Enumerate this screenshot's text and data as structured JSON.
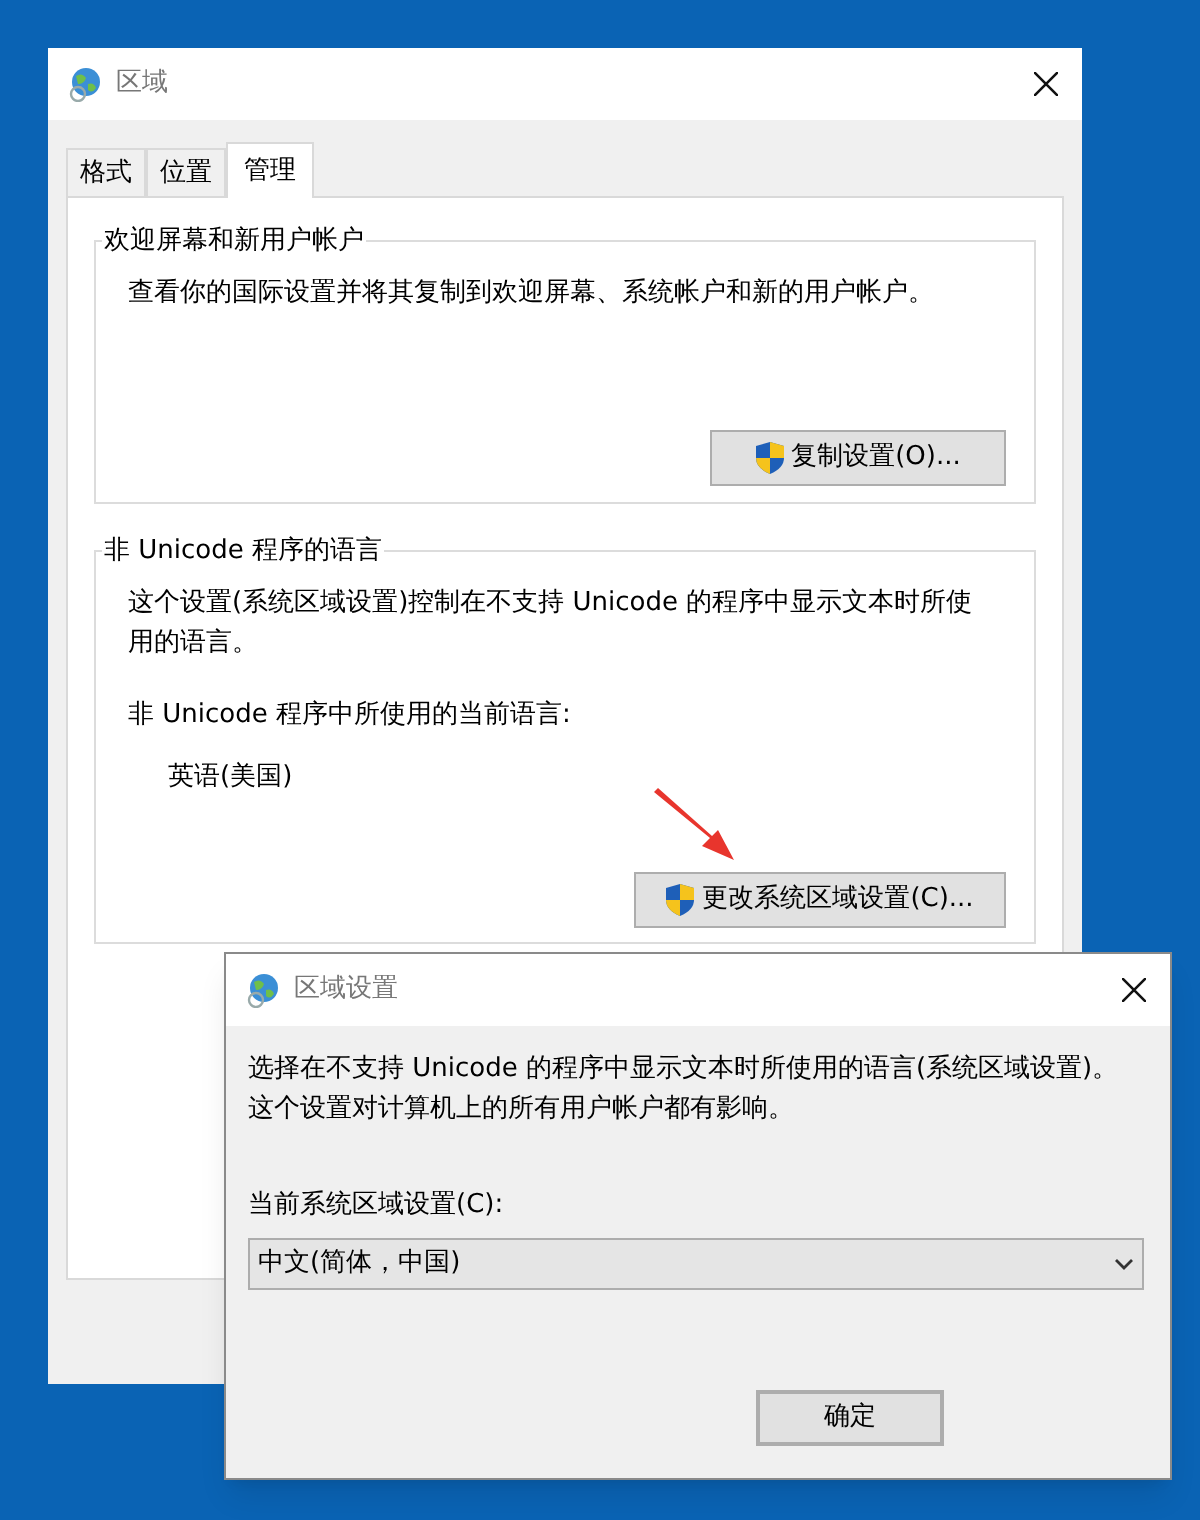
{
  "main_window": {
    "title": "区域",
    "tabs": [
      {
        "label": "格式",
        "selected": false
      },
      {
        "label": "位置",
        "selected": false
      },
      {
        "label": "管理",
        "selected": true
      }
    ],
    "groups": [
      {
        "title": "欢迎屏幕和新用户帐户",
        "description": "查看你的国际设置并将其复制到欢迎屏幕、系统帐户和新的用户帐户。",
        "button": "复制设置(O)..."
      },
      {
        "title": "非 Unicode 程序的语言",
        "description": "这个设置(系统区域设置)控制在不支持 Unicode 的程序中显示文本时所使用的语言。",
        "current_label": "非 Unicode 程序中所使用的当前语言:",
        "current_value": "英语(美国)",
        "button": "更改系统区域设置(C)..."
      }
    ]
  },
  "dialog": {
    "title": "区域设置",
    "description": "选择在不支持 Unicode 的程序中显示文本时所使用的语言(系统区域设置)。这个设置对计算机上的所有用户帐户都有影响。",
    "field_label": "当前系统区域设置(C):",
    "dropdown_value": "中文(简体，中国)",
    "buttons": [
      "确定"
    ]
  }
}
